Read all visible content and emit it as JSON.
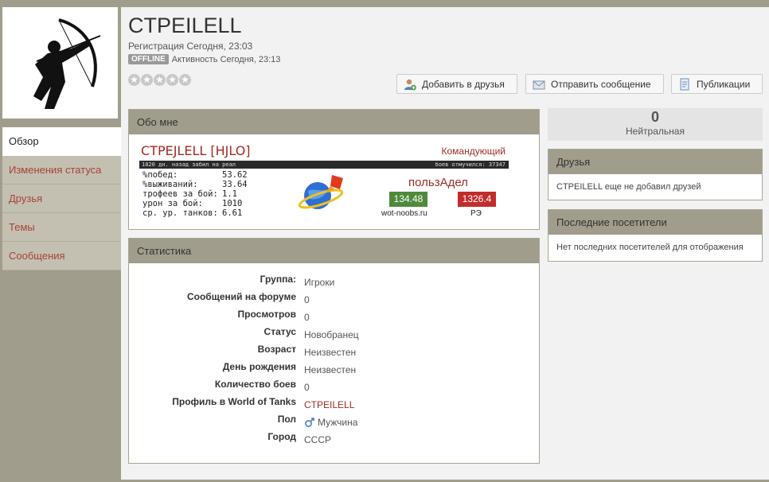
{
  "profile": {
    "username": "CTPEILELL",
    "registration": "Регистрация Сегодня, 23:03",
    "status_badge": "OFFLINE",
    "activity": "Активность Сегодня, 23:13",
    "rating_stars": 0
  },
  "buttons": {
    "add_friend": "Добавить в друзья",
    "send_message": "Отправить сообщение",
    "publications": "Публикации"
  },
  "sidebar": {
    "items": [
      {
        "label": "Обзор",
        "active": true
      },
      {
        "label": "Изменения статуса",
        "active": false
      },
      {
        "label": "Друзья",
        "active": false
      },
      {
        "label": "Темы",
        "active": false
      },
      {
        "label": "Сообщения",
        "active": false
      }
    ]
  },
  "about": {
    "title": "Обо мне",
    "signature": {
      "player_name": "CTPEJLELL [HJLO]",
      "rank": "Командующий",
      "bar_left": "1820 дн. назад забил на реал",
      "bar_right": "боев отмучился: 37347",
      "stats": [
        {
          "label": "%побед:",
          "value": "53.62"
        },
        {
          "label": "%выживаний:",
          "value": "33.64"
        },
        {
          "label": "трофеев за бой:",
          "value": "1.1"
        },
        {
          "label": "урон за бой:",
          "value": "1010"
        },
        {
          "label": "ср. ур. танков:",
          "value": "6.61"
        }
      ],
      "brand": "пользАдел",
      "wn_value": "134.48",
      "wn_label": "wot-noobs.ru",
      "re_value": "1326.4",
      "re_label": "РЭ"
    }
  },
  "statistics": {
    "title": "Статистика",
    "rows": [
      {
        "key": "Группа:",
        "value": "Игроки"
      },
      {
        "key": "Сообщений на форуме",
        "value": "0"
      },
      {
        "key": "Просмотров",
        "value": "0"
      },
      {
        "key": "Статус",
        "value": "Новобранец"
      },
      {
        "key": "Возраст",
        "value": "Неизвестен"
      },
      {
        "key": "День рождения",
        "value": "Неизвестен"
      },
      {
        "key": "Количество боев",
        "value": "0"
      },
      {
        "key": "Профиль в World of Tanks",
        "value": "CTPEILELL"
      },
      {
        "key": "Пол",
        "value": "Мужчина"
      },
      {
        "key": "Город",
        "value": "СССР"
      }
    ]
  },
  "reputation": {
    "value": "0",
    "label": "Нейтральная"
  },
  "friends": {
    "title": "Друзья",
    "text": "CTPEILELL еще не добавил друзей"
  },
  "visitors": {
    "title": "Последние посетители",
    "text": "Нет последних посетителей для отображения"
  },
  "colors": {
    "accent": "#a02b25",
    "frame": "#a09d8c",
    "wn_green": "#4e8a3a",
    "re_red": "#c22c2c"
  }
}
